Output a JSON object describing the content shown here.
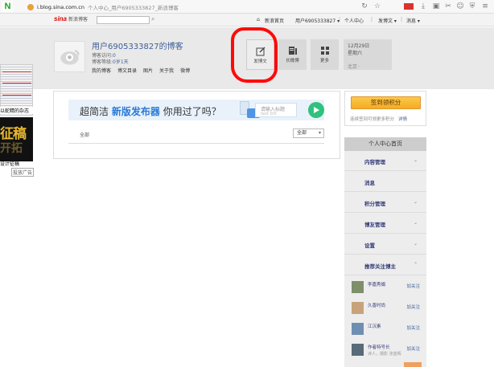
{
  "browser": {
    "logo": "N",
    "url": "i.blog.sina.com.cn",
    "tab_title": "个人中心_用户6905333827_新浪博客"
  },
  "topbar": {
    "logo": "sina",
    "logo_sub": "新浪博客",
    "links": [
      "新浪首页",
      "用户6905333827 ▾",
      "个人中心",
      "发博文 ▾",
      "消息 ▾"
    ]
  },
  "header": {
    "blog_title": "用户6905333827的博客",
    "visits_label": "博客访问:",
    "visits_value": "0",
    "age_label": "博客等级:",
    "age_value": "0岁1天",
    "nav": [
      "我的博客",
      "博文目录",
      "图片",
      "关于我",
      "微博"
    ],
    "tools": [
      {
        "label": "发博文",
        "icon": "edit-icon"
      },
      {
        "label": "长微博",
        "icon": "article-icon"
      },
      {
        "label": "更多",
        "icon": "grid-icon"
      }
    ],
    "date": "12月29日",
    "weekday": "星期六",
    "location": "北京 ·"
  },
  "left_ads": {
    "caption1": "以蛇精的杂志",
    "big_text": "征稿",
    "big_text2": "开拓",
    "caption2": "设计征稿",
    "caption3": "投放广告"
  },
  "main": {
    "promo_prefix": "超简洁",
    "promo_highlight": "新版发布器",
    "promo_suffix": "你用过了吗？",
    "promo_input_title": "请输入标题",
    "promo_input_sub": "text 0/0",
    "filter_label": "全部",
    "select_value": "全部"
  },
  "sidebar": {
    "sign_button": "签到领积分",
    "sign_note": "连续签到可领更多积分",
    "sign_detail": "详情",
    "menu_head": "个人中心首页",
    "menu": [
      {
        "label": "内容管理",
        "chev": "⌄"
      },
      {
        "label": "消息",
        "chev": ""
      },
      {
        "label": "积分管理",
        "chev": "⌄"
      },
      {
        "label": "博友管理",
        "chev": "⌄"
      },
      {
        "label": "设置",
        "chev": "⌄"
      },
      {
        "label": "推荐关注博主",
        "chev": "⌃"
      }
    ],
    "recommended": [
      {
        "name": "李嘉秀娟",
        "sub": "",
        "add": "加关注",
        "color": "#7e8f6a"
      },
      {
        "name": "久香时尚",
        "sub": "",
        "add": "加关注",
        "color": "#c8a27a"
      },
      {
        "name": "江沉素",
        "sub": "",
        "add": "加关注",
        "color": "#6f8fb2"
      },
      {
        "name": "作者特号长",
        "sub": "诗人，摄影 张金辉",
        "add": "加关注",
        "color": "#596b78"
      }
    ]
  }
}
